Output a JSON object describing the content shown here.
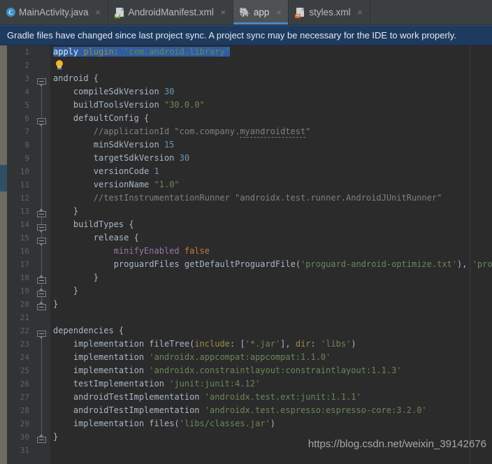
{
  "tabs": [
    {
      "label": "MainActivity.java",
      "icon": "java-class-icon",
      "active": false,
      "close": "×"
    },
    {
      "label": "AndroidManifest.xml",
      "icon": "manifest-file-icon",
      "badge": "MF",
      "active": false,
      "close": "×"
    },
    {
      "label": "app",
      "icon": "gradle-elephant-icon",
      "active": true,
      "close": "×"
    },
    {
      "label": "styles.xml",
      "icon": "xml-file-icon",
      "badge": "<>",
      "active": false,
      "close": "×"
    }
  ],
  "notification": {
    "message": "Gradle files have changed since last project sync. A project sync may be necessary for the IDE to work properly.",
    "background": "#1e3a5f"
  },
  "editor": {
    "language": "groovy-gradle",
    "selection_color": "#2f5d9e",
    "background": "#2b2b2b",
    "gutter_background": "#313335",
    "line_numbers": [
      1,
      2,
      3,
      4,
      5,
      6,
      7,
      8,
      9,
      10,
      11,
      12,
      13,
      14,
      15,
      16,
      17,
      18,
      19,
      20,
      21,
      22,
      23,
      24,
      25,
      26,
      27,
      28,
      29,
      30,
      31
    ],
    "intention_bulb": "lightbulb-icon",
    "lines": [
      {
        "n": 1,
        "text": "apply plugin: 'com.android.library'",
        "selected": true
      },
      {
        "n": 2,
        "text": ""
      },
      {
        "n": 3,
        "text": "android {"
      },
      {
        "n": 4,
        "text": "    compileSdkVersion 30"
      },
      {
        "n": 5,
        "text": "    buildToolsVersion \"30.0.0\""
      },
      {
        "n": 6,
        "text": "    defaultConfig {"
      },
      {
        "n": 7,
        "text": "        //applicationId \"com.company.myandroidtest\""
      },
      {
        "n": 8,
        "text": "        minSdkVersion 15"
      },
      {
        "n": 9,
        "text": "        targetSdkVersion 30"
      },
      {
        "n": 10,
        "text": "        versionCode 1"
      },
      {
        "n": 11,
        "text": "        versionName \"1.0\""
      },
      {
        "n": 12,
        "text": "        //testInstrumentationRunner \"androidx.test.runner.AndroidJUnitRunner\""
      },
      {
        "n": 13,
        "text": "    }"
      },
      {
        "n": 14,
        "text": "    buildTypes {"
      },
      {
        "n": 15,
        "text": "        release {"
      },
      {
        "n": 16,
        "text": "            minifyEnabled false"
      },
      {
        "n": 17,
        "text": "            proguardFiles getDefaultProguardFile('proguard-android-optimize.txt'), 'proguard-rules.pro'"
      },
      {
        "n": 18,
        "text": "        }"
      },
      {
        "n": 19,
        "text": "    }"
      },
      {
        "n": 20,
        "text": "}"
      },
      {
        "n": 21,
        "text": ""
      },
      {
        "n": 22,
        "text": "dependencies {"
      },
      {
        "n": 23,
        "text": "    implementation fileTree(include: ['*.jar'], dir: 'libs')"
      },
      {
        "n": 24,
        "text": "    implementation 'androidx.appcompat:appcompat:1.1.0'"
      },
      {
        "n": 25,
        "text": "    implementation 'androidx.constraintlayout:constraintlayout:1.1.3'"
      },
      {
        "n": 26,
        "text": "    testImplementation 'junit:junit:4.12'"
      },
      {
        "n": 27,
        "text": "    androidTestImplementation 'androidx.test.ext:junit:1.1.1'"
      },
      {
        "n": 28,
        "text": "    androidTestImplementation 'androidx.test.espresso:espresso-core:3.2.0'"
      },
      {
        "n": 29,
        "text": "    implementation files('libs/classes.jar')"
      },
      {
        "n": 30,
        "text": "}"
      },
      {
        "n": 31,
        "text": ""
      }
    ],
    "fold_markers": [
      {
        "line": 3,
        "dir": "down"
      },
      {
        "line": 6,
        "dir": "down"
      },
      {
        "line": 13,
        "dir": "up"
      },
      {
        "line": 14,
        "dir": "down"
      },
      {
        "line": 15,
        "dir": "down"
      },
      {
        "line": 18,
        "dir": "up"
      },
      {
        "line": 19,
        "dir": "up"
      },
      {
        "line": 20,
        "dir": "up"
      },
      {
        "line": 22,
        "dir": "down"
      },
      {
        "line": 30,
        "dir": "up"
      }
    ],
    "syntax_colors": {
      "keyword": "#cc7832",
      "string": "#6a8759",
      "number": "#6897bb",
      "comment": "#808080",
      "property": "#9876aa",
      "named_arg": "#9b8e4a",
      "default": "#a9b7c6"
    }
  },
  "watermark": {
    "text": "https://blog.csdn.net/weixin_39142676"
  }
}
